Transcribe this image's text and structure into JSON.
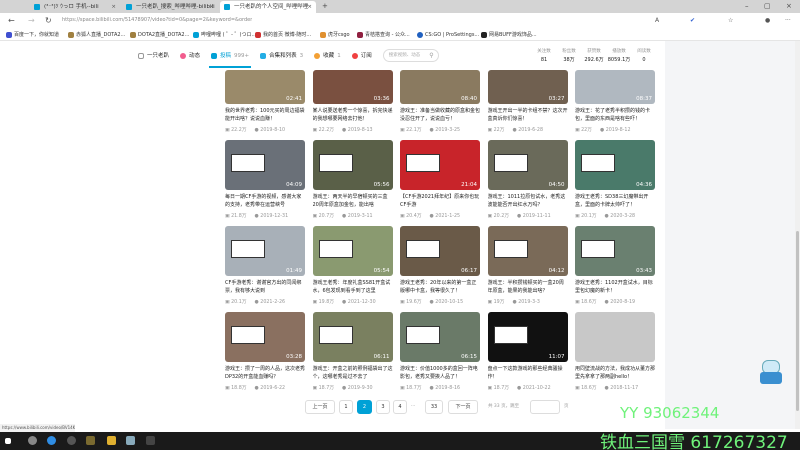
{
  "browser": {
    "tabs": [
      {
        "label": "(³⁻³)ﾂ ｳっロ 手机--bili"
      },
      {
        "label": "一只老趴_搜索_哔哩哔哩-bilibili"
      },
      {
        "label": "一只老趴的个人空间_哔哩哔哩"
      }
    ],
    "new_tab": "+",
    "url": "https://space.bilibili.com/51478907/video?tid=0&page=2&keyword=&order=pubdate",
    "bookmarks": [
      "百度一下，你就知道",
      "赤狐人直播_DOTA2...",
      "DOTA2直播_DOTA2...",
      "哔哩哔哩 ( ゜- ゜)つロ...",
      "我的首页 微博-随时...",
      "虎牙csgo",
      "青桔搭查询 - 公众...",
      "CS:GO | ProSettings...",
      "网易BUFF游戏饰品..."
    ],
    "status_url": "https://www.bilibili.com/video/BV14K411m7Bn"
  },
  "space_nav": {
    "items": [
      {
        "label": "一只老趴",
        "count": ""
      },
      {
        "label": "动态",
        "count": ""
      },
      {
        "label": "投稿",
        "count": "999+"
      },
      {
        "label": "合集和列表",
        "count": "3"
      },
      {
        "label": "收藏",
        "count": "1"
      },
      {
        "label": "订阅",
        "count": ""
      }
    ],
    "active": "投稿",
    "search_placeholder": "搜索视频、动态",
    "stats": [
      {
        "label": "关注数",
        "value": "81"
      },
      {
        "label": "粉丝数",
        "value": "38万"
      },
      {
        "label": "获赞数",
        "value": "292.6万"
      },
      {
        "label": "播放数",
        "value": "8059.1万"
      },
      {
        "label": "阅读数",
        "value": "0"
      }
    ]
  },
  "videos": [
    {
      "title": "我的世界老秀：100元买的周边福袋能开出啥？说说血赚！",
      "duration": "02:41",
      "plays": "22.2万",
      "date": "2019-8-10",
      "color": "#9a8a6a"
    },
    {
      "title": "某人说要送老秀一个惊喜，拆完快递的我想哪要网络去打他！",
      "duration": "03:36",
      "plays": "22.2万",
      "date": "2019-8-13",
      "color": "#7a5040"
    },
    {
      "title": "游戏王：准备当做收藏的原盒和金包没忍住开了，说说血亏！",
      "duration": "08:40",
      "plays": "22.1万",
      "date": "2019-3-25",
      "color": "#8a7a60"
    },
    {
      "title": "游戏王开出一半的卡组不禁？这次开盒真诉你们惊喜！",
      "duration": "03:27",
      "plays": "22万",
      "date": "2019-6-28",
      "color": "#706050"
    },
    {
      "title": "游戏王：花了老秀半积攒的钱的卡包，里面的东西是啥有些吓！",
      "duration": "08:37",
      "plays": "22万",
      "date": "2019-8-12",
      "color": "#b0b8c0"
    },
    {
      "title": "每日一期CF手游的视频，感谢大家的支持，老秀带在运营峡号",
      "duration": "04:09",
      "plays": "21.8万",
      "date": "2019-12-31",
      "color": "#6a7078"
    },
    {
      "title": "游戏王：两天半的早宿顿买的三盒20周年原盒加金包，能出啥",
      "duration": "05:56",
      "plays": "20.7万",
      "date": "2019-3-11",
      "color": "#5a6048"
    },
    {
      "title": "【CF手游2021拜年纪】原来你也玩CF手游",
      "duration": "21:04",
      "plays": "20.4万",
      "date": "2021-1-25",
      "color": "#c8242a"
    },
    {
      "title": "游戏王：1011拉原包试水，老秀这波能能否开出红水万吗？",
      "duration": "04:50",
      "plays": "20.2万",
      "date": "2019-11-11",
      "color": "#6a6a5a"
    },
    {
      "title": "游戏王老秀：SD38三幻魔带出开盒，里面的卡牌太帅吓了！",
      "duration": "04:36",
      "plays": "20.1万",
      "date": "2020-3-28",
      "color": "#4a7a6a"
    },
    {
      "title": "CF手游老秀：谢谢官方出的同闻绑票，我有够大说到",
      "duration": "01:49",
      "plays": "20.1万",
      "date": "2021-2-26",
      "color": "#a8b0b8"
    },
    {
      "title": "游戏王老秀：年度礼盒SS81开盒试水，6包发现到看手到了这里",
      "duration": "05:54",
      "plays": "19.8万",
      "date": "2021-12-30",
      "color": "#8a9a70"
    },
    {
      "title": "游戏王老秀：20年以来的第一盒正版哪中卡盒，我等很久了！",
      "duration": "06:17",
      "plays": "19.6万",
      "date": "2020-10-15",
      "color": "#6a5a48"
    },
    {
      "title": "游戏王：半积攒钱顿买的一盒20周年原盒，能果的我能出啥？",
      "duration": "04:12",
      "plays": "19万",
      "date": "2019-3-3",
      "color": "#7a6a58"
    },
    {
      "title": "游戏王老秀：1102开盒试水，目标里包幻魔的新卡！",
      "duration": "03:43",
      "plays": "18.6万",
      "date": "2020-8-19",
      "color": "#6a8070"
    },
    {
      "title": "游戏王：攒了一周的人品，这次老秀DP32的开盒能血赚吗？",
      "duration": "03:28",
      "plays": "18.8万",
      "date": "2019-6-22",
      "color": "#8a7060"
    },
    {
      "title": "游戏王：开盒之前的照例福袋出了这个，这哪老秀是过不去了",
      "duration": "06:11",
      "plays": "18.7万",
      "date": "2019-9-30",
      "color": "#7a8060"
    },
    {
      "title": "游戏王：价值1000多的盒回一阵电影包，老秀又要挨人品了！",
      "duration": "06:15",
      "plays": "18.7万",
      "date": "2019-8-16",
      "color": "#6a7a68"
    },
    {
      "title": "盘点一下这款游戏的那些经典骚操作！",
      "duration": "11:07",
      "plays": "18.7万",
      "date": "2021-10-22",
      "color": "#111111"
    },
    {
      "title": "用同壁流战的方法，我成功从董方那里先拿拿了那两副hello！",
      "duration": "",
      "plays": "18.6万",
      "date": "2018-11-17",
      "color": "#c8c8c8"
    }
  ],
  "pagination": {
    "prev": "上一页",
    "pages": [
      "1",
      "2",
      "3",
      "4"
    ],
    "ellipsis": "···",
    "last": "33",
    "current": "2",
    "next": "下一页",
    "total_text": "共 33 页，跳至",
    "suffix": "页"
  },
  "overlay": {
    "line1": "YY 93062344",
    "line2": "铁血三国雪 617267327"
  },
  "accent": "#00a1d6"
}
